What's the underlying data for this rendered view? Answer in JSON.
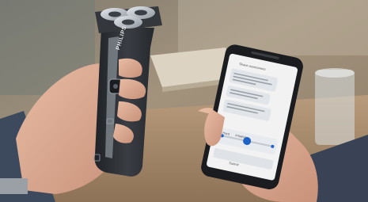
{
  "product": {
    "brand": "PHILIPS"
  },
  "phone": {
    "title": "Shave assessment",
    "option_a": "Hard",
    "option_b": "Irritation",
    "submit_label": "Submit"
  },
  "colors": {
    "background": "#9a8c78",
    "shaver_body": "#2c2f33",
    "shaver_chrome": "#c9ced4",
    "phone_body": "#1a1c1f",
    "screen": "#f2f2f2",
    "slider_accent": "#1e64c8",
    "skin": "#d9a88b"
  }
}
